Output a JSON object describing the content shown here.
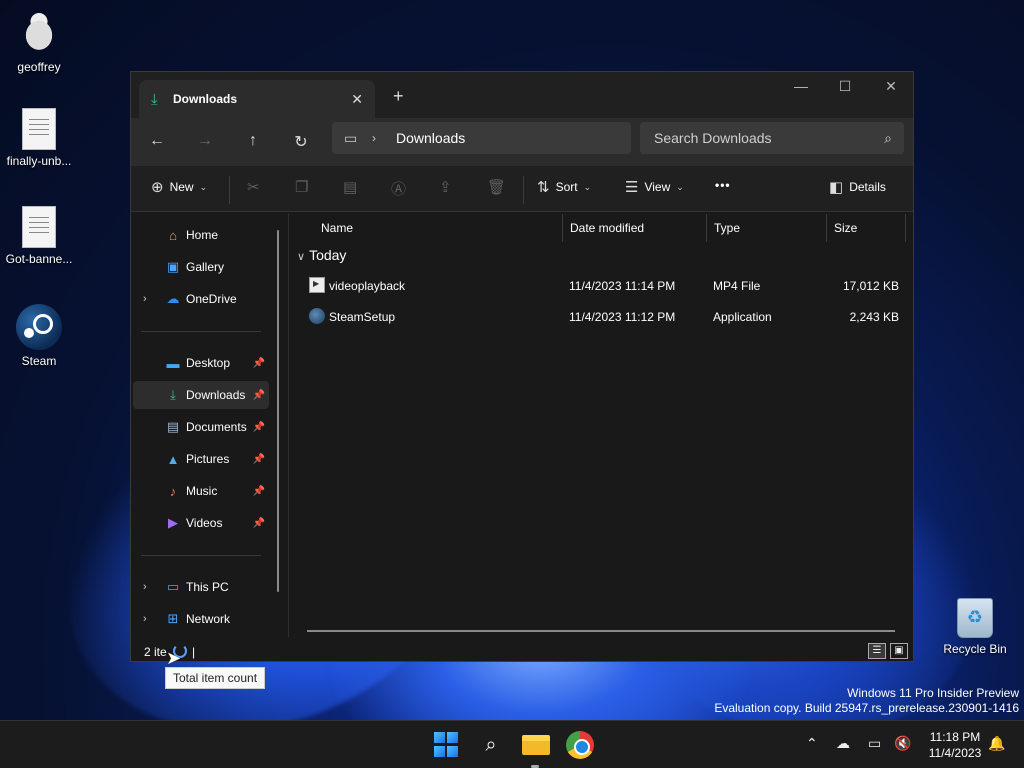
{
  "desktop": {
    "icons": [
      {
        "label": "geoffrey"
      },
      {
        "label": "finally-unb..."
      },
      {
        "label": "Got-banne..."
      },
      {
        "label": "Steam"
      },
      {
        "label": "Recycle Bin"
      }
    ],
    "watermark": {
      "line1": "Windows 11 Pro Insider Preview",
      "line2": "Evaluation copy. Build 25947.rs_prerelease.230901-1416"
    }
  },
  "window": {
    "tab_title": "Downloads",
    "close_tab_icon": "✕",
    "new_tab_icon": "+",
    "minimize_icon": "—",
    "maximize_icon": "☐",
    "close_icon": "✕",
    "address": {
      "location": "Downloads"
    },
    "search": {
      "placeholder": "Search Downloads"
    },
    "commands": {
      "new_label": "New",
      "sort_label": "Sort",
      "view_label": "View",
      "more_label": "•••",
      "details_label": "Details"
    },
    "nav": {
      "items": [
        {
          "label": "Home"
        },
        {
          "label": "Gallery"
        },
        {
          "label": "OneDrive"
        },
        {
          "label": "Desktop"
        },
        {
          "label": "Downloads"
        },
        {
          "label": "Documents"
        },
        {
          "label": "Pictures"
        },
        {
          "label": "Music"
        },
        {
          "label": "Videos"
        },
        {
          "label": "This PC"
        },
        {
          "label": "Network"
        }
      ]
    },
    "columns": {
      "name": "Name",
      "date": "Date modified",
      "type": "Type",
      "size": "Size"
    },
    "group_label": "Today",
    "files": [
      {
        "name": "videoplayback",
        "date": "11/4/2023 11:14 PM",
        "type": "MP4 File",
        "size": "17,012 KB"
      },
      {
        "name": "SteamSetup",
        "date": "11/4/2023 11:12 PM",
        "type": "Application",
        "size": "2,243 KB"
      }
    ],
    "status": {
      "count_text": "2 ite",
      "caret": "|"
    }
  },
  "tooltip": {
    "text": "Total item count"
  },
  "taskbar": {
    "clock_time": "11:18 PM",
    "clock_date": "11/4/2023"
  }
}
